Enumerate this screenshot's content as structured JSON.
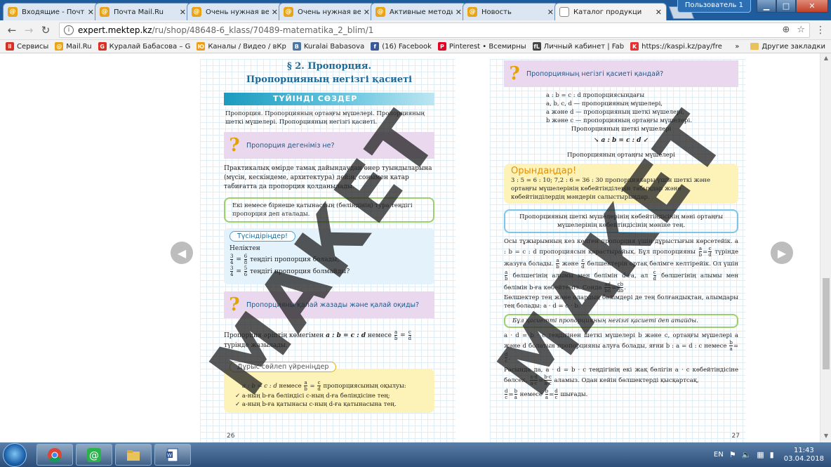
{
  "browser": {
    "tabs": [
      {
        "title": "Входящие - Почта",
        "color": "#e8a317",
        "glyph": "@"
      },
      {
        "title": "Почта Mail.Ru",
        "color": "#e8a317",
        "glyph": "@"
      },
      {
        "title": "Очень нужная вещ",
        "color": "#e8a317",
        "glyph": "@"
      },
      {
        "title": "Очень нужная вещ",
        "color": "#e8a317",
        "glyph": "@"
      },
      {
        "title": "Активные методы",
        "color": "#e8a317",
        "glyph": "@"
      },
      {
        "title": "Новость",
        "color": "#e8a317",
        "glyph": "@"
      },
      {
        "title": "Каталог продукци",
        "color": "#ffffff",
        "glyph": "",
        "active": true
      }
    ],
    "user_label": "Пользователь 1",
    "url_host": "expert.mektep.kz",
    "url_path": "/ru/shop/48648-6_klass/70489-matematika_2_blim/1",
    "bookmarks": [
      {
        "label": "Сервисы",
        "color": "#d93025",
        "glyph": "⠿"
      },
      {
        "label": "Mail.Ru",
        "color": "#e8a317",
        "glyph": "@"
      },
      {
        "label": "Куралай Бабасова – G",
        "color": "#d93025",
        "glyph": "G"
      },
      {
        "label": "Каналы / Видео / вКр",
        "color": "#f39c12",
        "glyph": "Ю"
      },
      {
        "label": "Kuralai Babasova",
        "color": "#4a76a8",
        "glyph": "В"
      },
      {
        "label": "(16) Facebook",
        "color": "#3b5998",
        "glyph": "f"
      },
      {
        "label": "Pinterest • Всемирны",
        "color": "#e60023",
        "glyph": "P"
      },
      {
        "label": "Личный кабинет | Fab",
        "color": "#444444",
        "glyph": "fL"
      },
      {
        "label": "https://kaspi.kz/pay/fre",
        "color": "#e6312e",
        "glyph": "K"
      }
    ],
    "bookmarks_overflow": "»",
    "other_bookmarks": "Другие закладки"
  },
  "left_page": {
    "title_line1": "§ 2. Пропорция.",
    "title_line2": "Пропорцияның негізгі қасиеті",
    "key_words_head": "ТҮЙІНДІ СӨЗДЕР",
    "key_words_text": "Пропорция. Пропорцияның ортаңғы мүшелері. Пропорцияның шеткі мүшелері. Пропорцияның негізгі қасиеті.",
    "q1": "Пропорция дегеніміз не?",
    "para1": "Практикалық өмірде тамақ дайындаудан өнер туындыларына (мүсін, кескіндеме, архитектура) дейін, сонымен қатар табиғатта да пропорция қолданылады.",
    "definition": "Екі немесе бірнеше қатынастың (бөліндінің) тура теңдігі пропорция деп аталады.",
    "explain_head": "Түсіндіріңдер!",
    "explain_why": "Неліктен",
    "explain_l1": "теңдігі пропорция болады,",
    "explain_l2": "теңдігі пропорция болмайды?",
    "q2": "Пропорцияны қалай жазады және қалай оқиды?",
    "para2a": "Пропорция әріптің көмегімен",
    "para2b": "a : b = c : d",
    "para2c": "немесе",
    "para2d": "түрінде жазылады.",
    "speak_head": "Дұрыс сөйлеп үйреніңдер",
    "speak_l1a": "a : b = c : d",
    "speak_l1b": "немесе",
    "speak_l1c": "пропорциясының оқылуы:",
    "speak_l2": "✓ a-ның b-ға бөліндісі c-ның d-ға бөліндісіне тең;",
    "speak_l3": "✓ a-ның b-ға қатынасы c-ның d-ға қатынасына тең.",
    "page_num": "26"
  },
  "right_page": {
    "q3": "Пропорцияның негізгі қасиеті қандай?",
    "l1": "a : b = c : d пропорциясындағы",
    "l2": "a, b, c, d — пропорцияның мүшелері,",
    "l3": "a және d — пропорцияның шеткі мүшелері,",
    "l4": "b және c — пропорцияның ортаңғы мүшелері.",
    "outer_label": "Пропорцияның шеткі мүшелері",
    "prop_expr": "a : b = c : d",
    "middle_label": "Пропорцияның ортаңғы мүшелері",
    "tasks_head": "Орындаңдар!",
    "tasks_text": "3 : 5 = 6 : 10; 7,2 : 6 = 36 : 30 пропорциялары үшін шеткі және ортаңғы мүшелерінің көбейтінділерін табыңдар және көбейтінділердің мәндерін салыстырыңдар.",
    "rule1": "Пропорцияның шеткі мүшелерінің көбейтіндісінің мәні ортаңғы мүшелерінің көбейтіндісінің мәніне тең.",
    "para3": "Осы тұжырымның кез келген пропорция үшін дұрыстығын көрсетейік. a : b = c : d пропорциясын қарастырайық. Бұл пропорцияны",
    "para3b": "түрінде жазуға болады.",
    "para3c": "және",
    "para3d": "бөлшектерін ортақ бөлімге келтірейік. Ол үшін",
    "para3e": "бөлшегінің алымы мен бөлімін d-ға, ал",
    "para3f": "бөлшегінің алымы мен бөлімін b-ға көбейтеміз. Сонда",
    "para3g": "Бөлшектер тең және олардың бөлімдері де тең болғандықтан, алымдары тең болады: a · d = c · b.",
    "rule2": "Бұл қасиетті пропорцияның негізгі қасиеті деп атайды.",
    "para4": "a · d = b · c теңдігінен шеткі мүшелері b және c, ортаңғы мүшелері a және d болатын пропорцияны алуға болады, яғни b : a = d : c немесе",
    "para5": "Расында да, a · d = b · c теңдігінің екі жақ бөлігін a · c көбейтіндісіне бөлсек,",
    "para5b": "аламыз. Одан кейін бөлшектерді қысқартсақ,",
    "para6a": "немесе",
    "para6b": "шығады.",
    "page_num": "27"
  },
  "watermark": "МАКЕТ",
  "taskbar": {
    "lang": "EN",
    "time": "11:43",
    "date": "03.04.2018"
  }
}
